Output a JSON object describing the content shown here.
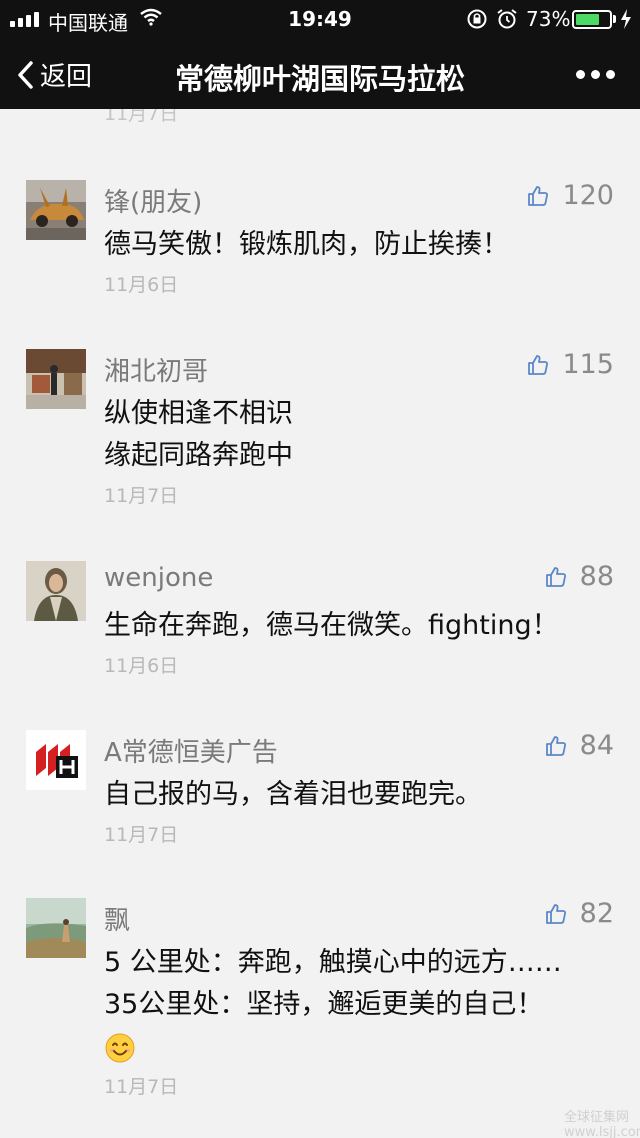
{
  "status_bar": {
    "carrier": "中国联通",
    "time": "19:49",
    "battery_text": "73%",
    "battery_level": 0.73,
    "battery_color": "#4cd964"
  },
  "nav": {
    "back_label": "返回",
    "title": "常德柳叶湖国际马拉松"
  },
  "top_partial_date": "11月7日",
  "comments": [
    {
      "nickname": "锋(朋友)",
      "likes": "120",
      "lines": [
        "德马笑傲！锻炼肌肉，防止挨揍！"
      ],
      "date": "11月6日",
      "avatar": "car-avatar"
    },
    {
      "nickname": "湘北初哥",
      "likes": "115",
      "lines": [
        "纵使相逢不相识",
        "缘起同路奔跑中"
      ],
      "date": "11月7日",
      "avatar": "person-avatar"
    },
    {
      "nickname": "wenjone",
      "likes": "88",
      "lines": [
        "生命在奔跑，德马在微笑。fighting！"
      ],
      "date": "11月6日",
      "avatar": "portrait-avatar"
    },
    {
      "nickname": "A常德恒美广告",
      "likes": "84",
      "lines": [
        "自己报的马，含着泪也要跑完。"
      ],
      "date": "11月7日",
      "avatar": "logo-avatar"
    },
    {
      "nickname": "飘",
      "likes": "82",
      "lines": [
        "5 公里处：奔跑，触摸心中的远方……",
        "35公里处：坚持，邂逅更美的自己！"
      ],
      "date": "11月7日",
      "avatar": "nature-avatar",
      "emoji": "smile-emoji"
    }
  ],
  "watermark": "全球征集网 www.lsjj.com",
  "colors": {
    "bar": "#111111",
    "background": "#f2f2f2",
    "nickname": "#7a7a7a",
    "date": "#b8b8b8"
  }
}
